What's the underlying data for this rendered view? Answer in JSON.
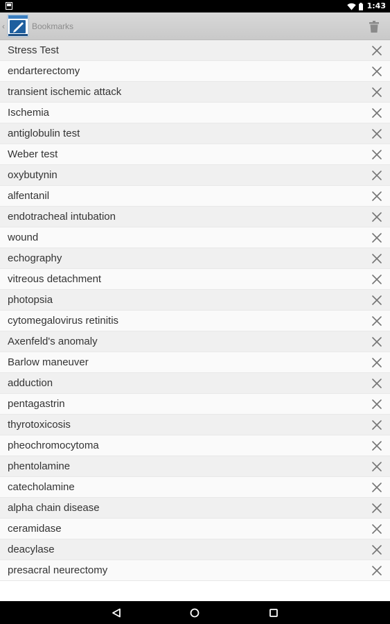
{
  "status_bar": {
    "time": "1:43",
    "icons": [
      "notification-icon",
      "wifi-icon",
      "battery-icon"
    ]
  },
  "action_bar": {
    "title": "Bookmarks",
    "icons": [
      "up-chevron-icon",
      "app-logo-icon",
      "trash-icon"
    ]
  },
  "bookmarks": [
    "Stress Test",
    "endarterectomy",
    "transient ischemic attack",
    "Ischemia",
    "antiglobulin test",
    "Weber test",
    "oxybutynin",
    "alfentanil",
    "endotracheal intubation",
    "wound",
    "echography",
    "vitreous detachment",
    "photopsia",
    "cytomegalovirus retinitis",
    "Axenfeld's anomaly",
    "Barlow maneuver",
    "adduction",
    "pentagastrin",
    "thyrotoxicosis",
    "pheochromocytoma",
    "phentolamine",
    "catecholamine",
    "alpha chain disease",
    "ceramidase",
    "deacylase",
    "presacral neurectomy"
  ],
  "nav_bar": {
    "icons": [
      "back-icon",
      "home-icon",
      "recents-icon"
    ]
  },
  "colors": {
    "action_bar": "#c9c9c9",
    "row_odd": "#f0f0f0",
    "row_even": "#fafafa",
    "text": "#333333",
    "icon": "#757575"
  }
}
